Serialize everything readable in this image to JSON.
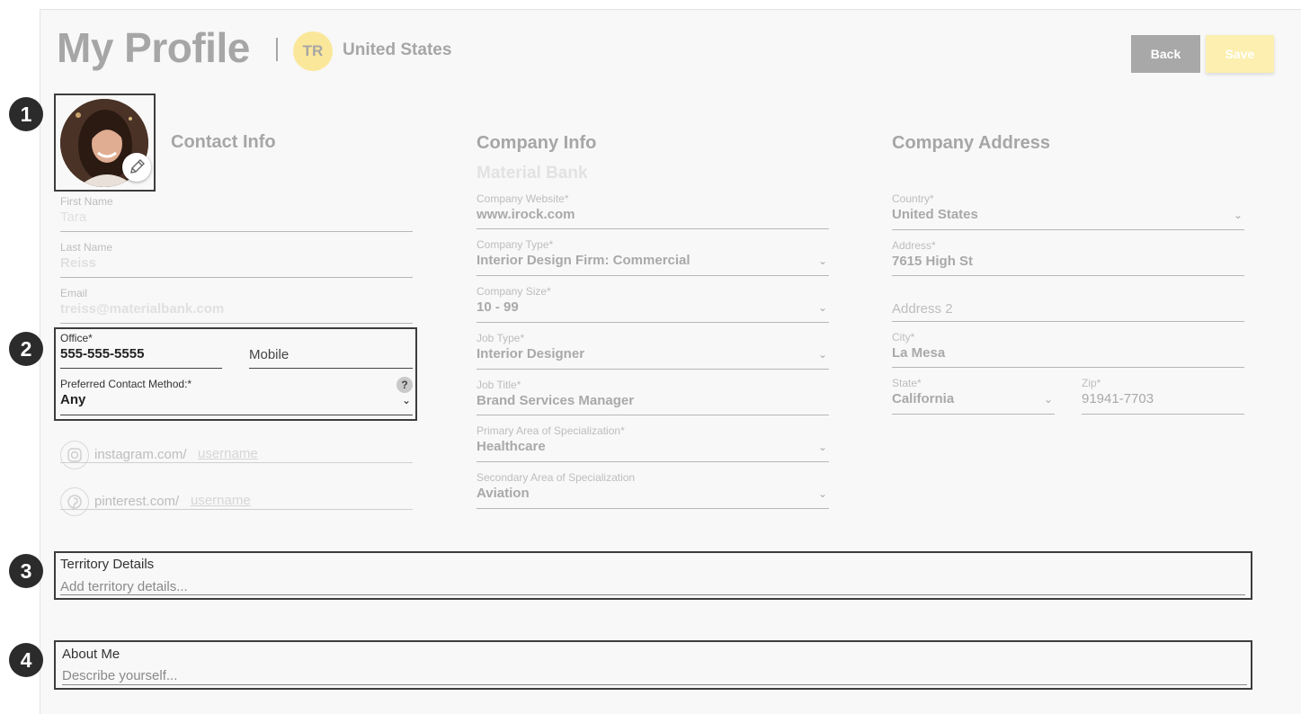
{
  "header": {
    "title": "My Profile",
    "initials": "TR",
    "country": "United States",
    "back_label": "Back",
    "save_label": "Save"
  },
  "markers": [
    "1",
    "2",
    "3",
    "4"
  ],
  "contact": {
    "title": "Contact Info",
    "first_name": {
      "label": "First Name",
      "value": "Tara"
    },
    "last_name": {
      "label": "Last Name",
      "value": "Reiss"
    },
    "email": {
      "label": "Email",
      "value": "treiss@materialbank.com"
    },
    "office": {
      "label": "Office*",
      "value": "555-555-5555"
    },
    "mobile": {
      "placeholder": "Mobile"
    },
    "preferred": {
      "label": "Preferred Contact Method:*",
      "value": "Any"
    },
    "help": "?",
    "instagram": {
      "prefix": "instagram.com/",
      "placeholder": "username"
    },
    "pinterest": {
      "prefix": "pinterest.com/",
      "placeholder": "username"
    }
  },
  "company": {
    "title": "Company Info",
    "name": "Material Bank",
    "website": {
      "label": "Company Website*",
      "value": "www.irock.com"
    },
    "type": {
      "label": "Company Type*",
      "value": "Interior Design Firm: Commercial"
    },
    "size": {
      "label": "Company Size*",
      "value": "10 - 99"
    },
    "job_type": {
      "label": "Job Type*",
      "value": "Interior Designer"
    },
    "job_title": {
      "label": "Job Title*",
      "value": "Brand Services Manager"
    },
    "primary": {
      "label": "Primary Area of Specialization*",
      "value": "Healthcare"
    },
    "secondary": {
      "label": "Secondary Area of Specialization",
      "value": "Aviation"
    }
  },
  "address": {
    "title": "Company Address",
    "country": {
      "label": "Country*",
      "value": "United States"
    },
    "address1": {
      "label": "Address*",
      "value": "7615 High St"
    },
    "address2": {
      "placeholder": "Address 2"
    },
    "city": {
      "label": "City*",
      "value": "La Mesa"
    },
    "state": {
      "label": "State*",
      "value": "California"
    },
    "zip": {
      "label": "Zip*",
      "value": "91941-7703"
    }
  },
  "territory": {
    "label": "Territory Details",
    "placeholder": "Add territory details..."
  },
  "about": {
    "label": "About Me",
    "placeholder": "Describe yourself..."
  },
  "icons": {
    "chevron": "⌄",
    "edit": "pencil-icon",
    "instagram": "instagram-icon",
    "pinterest": "pinterest-icon"
  },
  "colors": {
    "accent": "#fbe79a",
    "back_button": "#a8a8a8",
    "save_button": "#fcefb0",
    "marker": "#2b2b2b"
  }
}
